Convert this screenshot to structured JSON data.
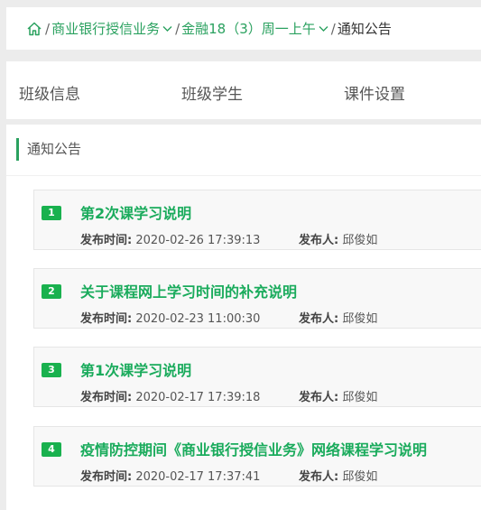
{
  "breadcrumb": {
    "home_icon": "home-icon",
    "items": [
      {
        "label": "商业银行授信业务",
        "has_dropdown": true
      },
      {
        "label": "金融18（3）周一上午",
        "has_dropdown": true
      }
    ],
    "current": "通知公告",
    "separator": "/",
    "accent": "#2aa15f"
  },
  "tabs": [
    "班级信息",
    "班级学生",
    "课件设置"
  ],
  "panel": {
    "title": "通知公告"
  },
  "notice_labels": {
    "time": "发布时间:",
    "author": "发布人:"
  },
  "notices": [
    {
      "num": "1",
      "title": "第2次课学习说明",
      "time": "2020-02-26 17:39:13",
      "author": "邱俊如"
    },
    {
      "num": "2",
      "title": "关于课程网上学习时间的补充说明",
      "time": "2020-02-23 11:00:30",
      "author": "邱俊如"
    },
    {
      "num": "3",
      "title": "第1次课学习说明",
      "time": "2020-02-17 17:39:18",
      "author": "邱俊如"
    },
    {
      "num": "4",
      "title": "疫情防控期间《商业银行授信业务》网络课程学习说明",
      "time": "2020-02-17 17:37:41",
      "author": "邱俊如"
    }
  ]
}
